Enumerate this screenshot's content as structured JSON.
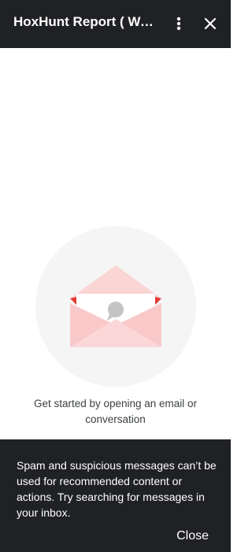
{
  "header": {
    "title": "HoxHunt Report ( Wa…"
  },
  "empty_state": {
    "message": "Get started by opening an email or conversation"
  },
  "snackbar": {
    "message": "Spam and suspicious messages can’t be used for recommended content or actions. Try searching for messages in your inbox.",
    "close_label": "Close"
  },
  "icons": {
    "more": "more-vert-icon",
    "close": "close-icon",
    "illustration": "open-envelope-chat-icon"
  },
  "colors": {
    "header_bg": "#202124",
    "envelope": "#f9cfcf",
    "envelope_accent": "#e53935"
  }
}
